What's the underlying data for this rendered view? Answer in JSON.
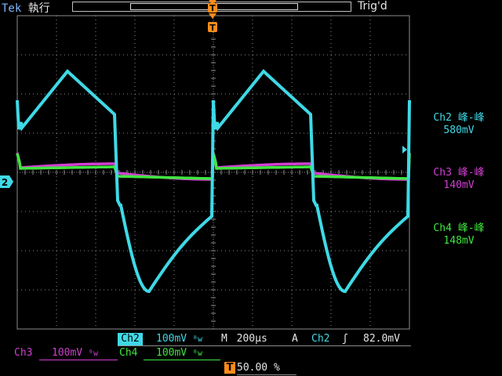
{
  "header": {
    "brand": "Tek",
    "run_state": "執行",
    "trigger_status": "Trig'd"
  },
  "markers": {
    "trigger_position": "T",
    "channel_ground": "2"
  },
  "measurements": [
    {
      "label": "Ch2 峰-峰",
      "value": "580mV",
      "color": "#3fd9e6"
    },
    {
      "label": "Ch3 峰-峰",
      "value": "140mV",
      "color": "#d23fd2"
    },
    {
      "label": "Ch4 峰-峰",
      "value": "148mV",
      "color": "#3fe63f"
    }
  ],
  "status": {
    "ch2_label": "Ch2",
    "ch2_scale": "100mV",
    "ch3_label": "Ch3",
    "ch3_scale": "100mV",
    "ch4_label": "Ch4",
    "ch4_scale": "100mV",
    "bw_symbol": "ᴮw",
    "timebase_label": "M",
    "timebase": "200µs",
    "trigger_mode": "A",
    "trigger_source": "Ch2",
    "trigger_slope": "ʃ",
    "trigger_level": "82.0mV",
    "trigger_pos_label": "T",
    "trigger_pos": "50.00 %"
  },
  "colors": {
    "ch2": "#3fd9e6",
    "ch3": "#d23fd2",
    "ch4": "#3fe63f",
    "grid": "#8c8c8c",
    "trigger": "#ff8c1a"
  }
}
